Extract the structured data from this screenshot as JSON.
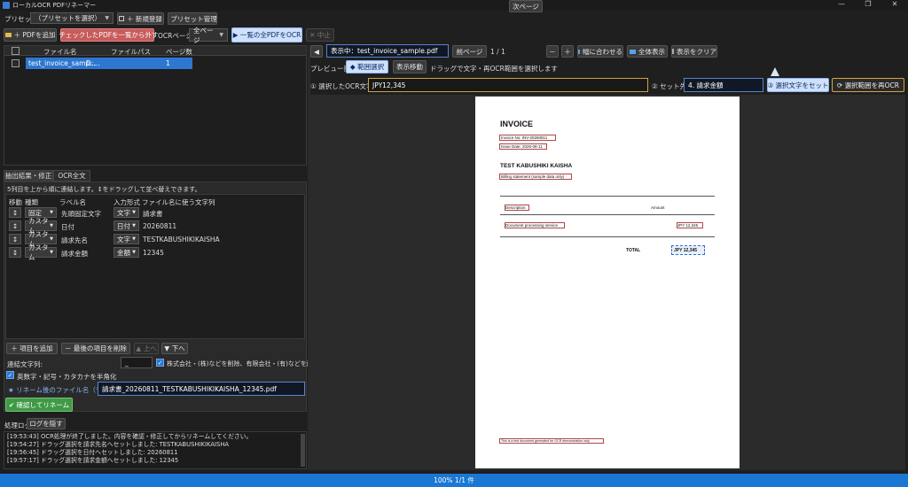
{
  "window": {
    "title": "ローカルOCR PDFリネーマー",
    "minimize": "—",
    "maximize": "❐",
    "close": "✕"
  },
  "preset": {
    "label": "プリセット:",
    "selected": "（プリセットを選択）",
    "new_button": "＋ 新規登録",
    "manage_button": "プリセット管理"
  },
  "toolbar": {
    "add_pdf": "＋ PDFを追加",
    "remove_checked": "チェックしたPDFを一覧から外す",
    "ocr_page_label": "OCRページ:",
    "ocr_page_value": "全ページ",
    "ocr_all": "▶ 一覧の全PDFをOCR",
    "stop": "✕ 中止"
  },
  "file_table": {
    "headers": [
      "ファイル名",
      "ファイルパス",
      "ページ数"
    ],
    "rows": [
      {
        "name": "test_invoice_samp...",
        "path": "D:...",
        "pages": "1"
      }
    ]
  },
  "extract_tabs": {
    "active": "抽出結果・修正",
    "other": "OCR全文"
  },
  "extract_hint": "5列目を上から順に連結します。↕をドラッグして並べ替えできます。",
  "extract_headers": [
    "移動",
    "種類",
    "ラベル名",
    "入力形式",
    "ファイル名に使う文字列"
  ],
  "extract_rows": [
    {
      "move": "↕",
      "type": "固定",
      "label": "先頭固定文字",
      "format": "文字",
      "value": "請求書"
    },
    {
      "move": "↕",
      "type": "カスタム",
      "label": "日付",
      "format": "日付",
      "value": "20260811"
    },
    {
      "move": "↕",
      "type": "カスタム",
      "label": "請求先名",
      "format": "文字",
      "value": "TESTKABUSHIKIKAISHA"
    },
    {
      "move": "↕",
      "type": "カスタム",
      "label": "請求金額",
      "format": "金額",
      "value": "12345"
    }
  ],
  "item_buttons": {
    "add": "＋ 項目を追加",
    "delete_last": "－ 最後の項目を削除",
    "up": "▲ 上へ",
    "down": "▼ 下へ"
  },
  "options": {
    "separator_label": "連結文字列:",
    "separator_value": "_",
    "company_abbrev": "株式会社・(株)などを削除、有限会社・(有)などを削へ変換",
    "halfwidth": "英数字・記号・カタカナを半角化"
  },
  "rename": {
    "label": "★ リネーム後のファイル名（予定）",
    "value": "請求書_20260811_TESTKABUSHIKIKAISHA_12345.pdf",
    "confirm_button": "✔ 確認してリネーム"
  },
  "log": {
    "label": "処理ログ",
    "hide_button": "ログを隠す",
    "lines": [
      "[19:53:43] OCR処理が終了しました。内容を確認・修正してからリネームしてください。",
      "[19:54:27] ドラッグ選択を請求先名へセットしました: TESTKABUSHIKIKAISHA",
      "[19:56:45] ドラッグ選択を日付へセットしました: 20260811",
      "[19:57:17] ドラッグ選択を請求金額へセットしました: 12345"
    ]
  },
  "viewer": {
    "prev_icon": "◀",
    "current_file": "表示中：test_invoice_sample.pdf",
    "prev_page": "前ページ",
    "page_count": "1 / 1",
    "next_page": "次ページ",
    "zoom_out": "－",
    "zoom_in": "＋",
    "fit_width": "幅に合わせる",
    "fit_all": "全体表示",
    "clear": "表示をクリア",
    "op_label": "プレビュー操作:",
    "range_select": "◆ 範囲選択",
    "move_view": "表示移動",
    "drag_hint": "ドラッグで文字・再OCR範囲を選択します",
    "ocr_label": "① 選択したOCR文字:",
    "ocr_value": "JPY12,345",
    "target_label": "② セット先:",
    "target_value": "4. 請求金額",
    "set_button": "③ 選択文字をセット",
    "reocr_button": "⟳ 選択範囲を再OCR"
  },
  "invoice": {
    "title": "INVOICE",
    "line1": "Invoice No: INV-20260811",
    "line2": "Issue Date: 2026-08-11",
    "company": "TEST KABUSHIKI KAISHA",
    "bill_note": "Billing statement (sample data only)",
    "col_desc": "Description",
    "col_amount": "Amount",
    "item_desc": "Document processing service",
    "item_amount": "JPY 12,345",
    "total_label": "TOTAL",
    "total_value": "JPY 12,345",
    "footer": "This is a test document generated for OCR demonstration only."
  },
  "status": {
    "text": "100%  1/1 件"
  }
}
